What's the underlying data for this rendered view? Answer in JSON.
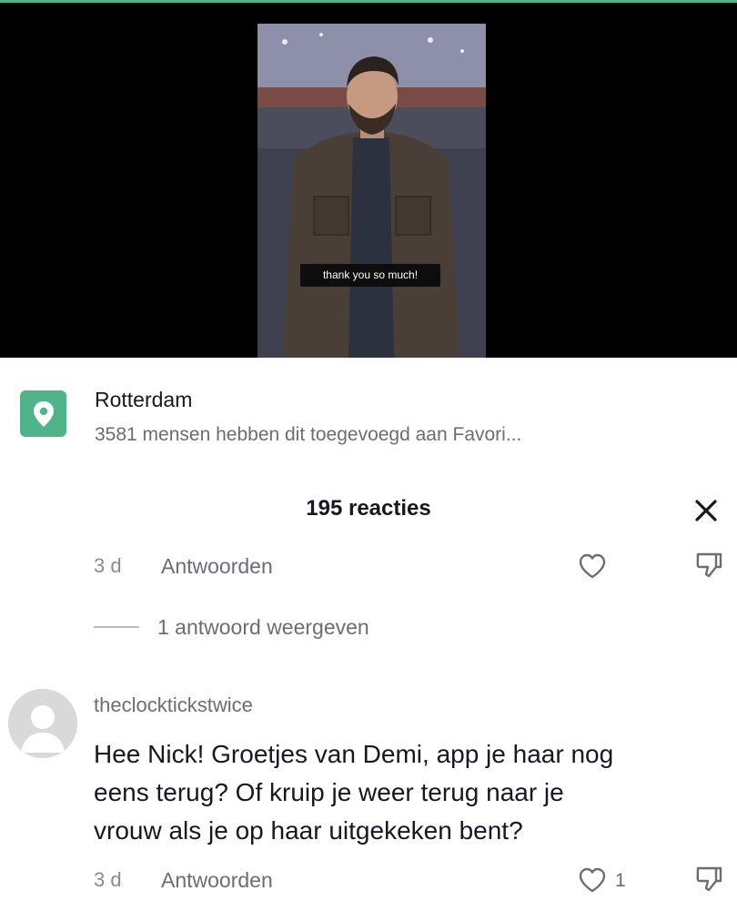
{
  "video": {
    "caption": "thank you so much!"
  },
  "location": {
    "icon": "location-pin-icon",
    "name": "Rotterdam",
    "subtitle": "3581 mensen hebben dit toegevoegd aan Favori..."
  },
  "comments_panel": {
    "title": "195 reacties",
    "close_icon": "close-icon"
  },
  "comment_1": {
    "time": "3 d",
    "reply_label": "Antwoorden",
    "like_icon": "heart-outline-icon",
    "dislike_icon": "thumbs-down-icon",
    "view_replies": "1 antwoord weergeven"
  },
  "comment_2": {
    "username": "theclocktickstwice",
    "lines": [
      "Hee Nick! Groetjes van Demi, app je haar nog",
      "eens terug? Of kruip je weer terug naar je",
      "vrouw als je op haar uitgekeken bent?"
    ],
    "time": "3 d",
    "reply_label": "Antwoorden",
    "like_count": "1",
    "like_icon": "heart-outline-icon",
    "dislike_icon": "thumbs-down-icon"
  },
  "colors": {
    "accent_green": "#4fb48a",
    "text_primary": "#161823",
    "text_secondary": "#6b6d76"
  }
}
